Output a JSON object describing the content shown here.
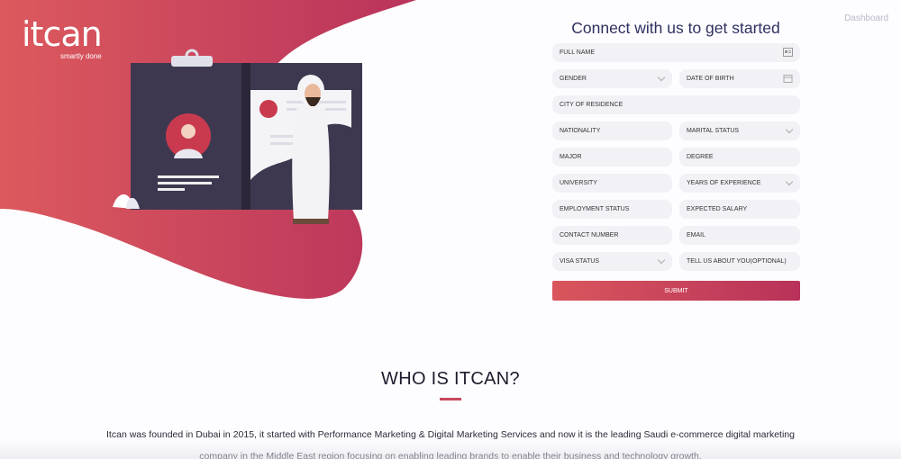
{
  "brand": {
    "name": "itcan",
    "tagline": "smartly done"
  },
  "nav": {
    "dashboard": "Dashboard"
  },
  "form": {
    "title": "Connect with us to get started",
    "fields": {
      "full_name": "FULL NAME",
      "gender": "GENDER",
      "dob": "DATE OF BIRTH",
      "city": "CITY OF RESIDENCE",
      "nationality": "NATIONALITY",
      "marital": "MARITAL STATUS",
      "major": "MAJOR",
      "degree": "DEGREE",
      "university": "UNIVERSITY",
      "experience": "YEARS OF EXPERIENCE",
      "employment": "EMPLOYMENT STATUS",
      "salary": "EXPECTED SALARY",
      "contact": "CONTACT NUMBER",
      "email": "EMAIL",
      "visa": "VISA STATUS",
      "about": "TELL US ABOUT YOU(OPTIONAL)"
    },
    "submit": "SUBMIT"
  },
  "about": {
    "title": "WHO IS ITCAN?",
    "text": "Itcan was founded in Dubai in 2015, it started with Performance Marketing & Digital Marketing Services and now it is the leading Saudi e-commerce digital marketing company in the Middle East region focusing on enabling leading brands to enable their business and technology growth."
  },
  "colors": {
    "brand_start": "#d9565c",
    "brand_end": "#b8325a",
    "title": "#2d3160",
    "field_bg": "#f2f1f6",
    "board": "#3d3850"
  },
  "icons": [
    "id-card-icon",
    "chevron-down-icon",
    "calendar-icon",
    "blood-drop-icon"
  ]
}
